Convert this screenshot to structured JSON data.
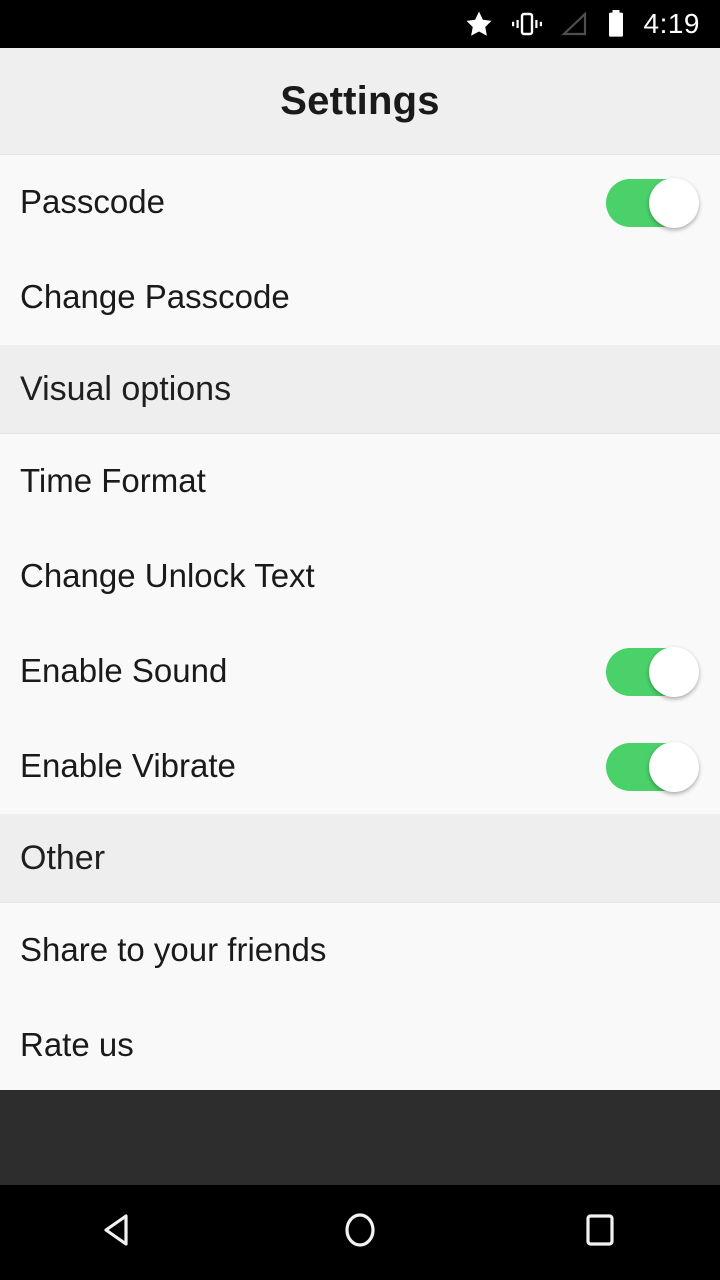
{
  "status_bar": {
    "icons": [
      "star-icon",
      "vibrate-icon",
      "signal-no-service-icon",
      "battery-full-icon"
    ],
    "time": "4:19"
  },
  "header": {
    "title": "Settings"
  },
  "colors": {
    "toggle_on": "#4ad16a",
    "section_background": "#eeeeee",
    "row_background": "#f9f9f9",
    "title_background": "#efefef",
    "nav_background": "#000000",
    "filler_background": "#2d2d2d"
  },
  "list": {
    "sections": [
      {
        "header": null,
        "rows": [
          {
            "label": "Passcode",
            "control": "toggle",
            "toggle_state": "on"
          },
          {
            "label": "Change Passcode",
            "control": "none",
            "toggle_state": null
          }
        ]
      },
      {
        "header": "Visual options",
        "rows": [
          {
            "label": "Time Format",
            "control": "none",
            "toggle_state": null
          },
          {
            "label": "Change Unlock Text",
            "control": "none",
            "toggle_state": null
          },
          {
            "label": "Enable Sound",
            "control": "toggle",
            "toggle_state": "on"
          },
          {
            "label": "Enable Vibrate",
            "control": "toggle",
            "toggle_state": "on"
          }
        ]
      },
      {
        "header": "Other",
        "rows": [
          {
            "label": "Share to your friends",
            "control": "none",
            "toggle_state": null
          },
          {
            "label": "Rate us",
            "control": "none",
            "toggle_state": null
          }
        ]
      }
    ]
  },
  "nav_bar": {
    "buttons": [
      {
        "name": "back-button",
        "icon": "back-triangle-icon"
      },
      {
        "name": "home-button",
        "icon": "home-circle-icon"
      },
      {
        "name": "recents-button",
        "icon": "recents-square-icon"
      }
    ]
  }
}
